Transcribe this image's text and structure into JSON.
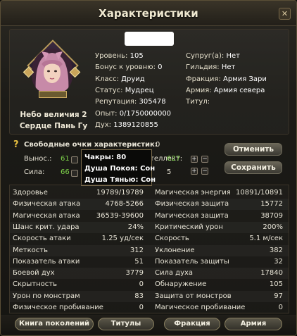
{
  "window": {
    "title": "Характеристики",
    "close_icon": "close-icon"
  },
  "portrait": {
    "rank_line1": "Небо величия 2",
    "rank_line2": "Сердце Пань Гу"
  },
  "info_left": [
    {
      "label": "Уровень:",
      "value": "105"
    },
    {
      "label": "Бонус к уровню:",
      "value": "0"
    },
    {
      "label": "Класс:",
      "value": "Друид"
    },
    {
      "label": "Статус:",
      "value": "Мудрец"
    },
    {
      "label": "Репутация:",
      "value": "305478"
    },
    {
      "label": "Опыт:",
      "value": "0/1750000000"
    },
    {
      "label": "Дух:",
      "value": "1389120855"
    }
  ],
  "info_right": [
    {
      "label": "Супруг(а):",
      "value": "Нет"
    },
    {
      "label": "Гильдия:",
      "value": "Нет"
    },
    {
      "label": "Фракция:",
      "value": "Армия Зари"
    },
    {
      "label": "Армия:",
      "value": "Армия севера"
    },
    {
      "label": "Титул:",
      "value": ""
    }
  ],
  "free_points": {
    "label": "Свободные очки характеристик:",
    "value": "0"
  },
  "attrs": [
    {
      "label": "Вынос.:",
      "value": "61"
    },
    {
      "label": "Сила:",
      "value": "66"
    },
    {
      "label": "Интеллект:",
      "value": "627"
    },
    {
      "label": "",
      "value": "5"
    }
  ],
  "buttons": {
    "cancel": "Отменить",
    "save": "Сохранить"
  },
  "tooltip": [
    {
      "text": "Чакры: 80"
    },
    {
      "text": "Душа Покоя: Сон"
    },
    {
      "text": "Душа Тянью: Сон"
    }
  ],
  "table": [
    {
      "l": "Здоровье",
      "lv": "19789/19789",
      "r": "Магическая энергия",
      "rv": "10891/10891"
    },
    {
      "l": "Физическая атака",
      "lv": "4768-5266",
      "r": "Физическая защита",
      "rv": "15772"
    },
    {
      "l": "Магическая атака",
      "lv": "36539-39600",
      "r": "Магическая защита",
      "rv": "38709"
    },
    {
      "l": "Шанс крит. удара",
      "lv": "24%",
      "r": "Критический урон",
      "rv": "200%"
    },
    {
      "l": "Скорость атаки",
      "lv": "1.25 уд/сек",
      "r": "Скорость",
      "rv": "5.1 м/сек"
    },
    {
      "l": "Меткость",
      "lv": "312",
      "r": "Уклонение",
      "rv": "382"
    },
    {
      "l": "Показатель атаки",
      "lv": "51",
      "r": "Показатель защиты",
      "rv": "32"
    },
    {
      "l": "Боевой дух",
      "lv": "3779",
      "r": "Сила духа",
      "rv": "17840"
    },
    {
      "l": "Скрытность",
      "lv": "0",
      "r": "Обнаружение",
      "rv": "105"
    },
    {
      "l": "Урон по монстрам",
      "lv": "83",
      "r": "Защита от монстров",
      "rv": "97"
    },
    {
      "l": "Физическое пробивание",
      "lv": "0",
      "r": "Магическое пробивание",
      "rv": "0"
    }
  ],
  "bottom": [
    "Книга поколений",
    "Титулы",
    "Фракция",
    "Армия"
  ],
  "colors": {
    "green": "#7ed24a",
    "accent": "#c9a55a"
  }
}
